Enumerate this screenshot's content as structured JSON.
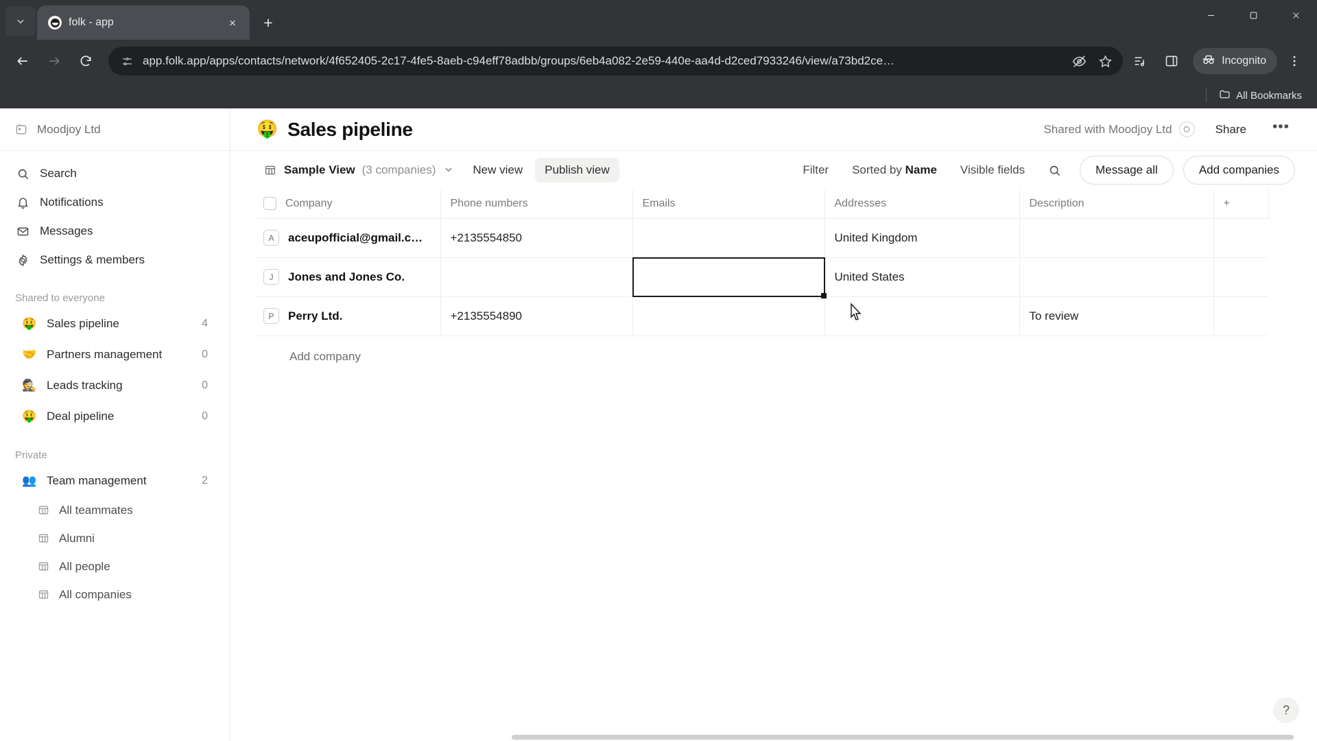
{
  "browser": {
    "tab": {
      "title": "folk - app",
      "favicon": "folk-logo-icon",
      "close_label": "×"
    },
    "new_tab_label": "+",
    "tab_search_icon": "chevron-down-icon",
    "window_controls": {
      "minimize": "minimize-icon",
      "maximize": "maximize-icon",
      "close": "close-icon"
    },
    "nav": {
      "back": "back-arrow-icon",
      "forward": "forward-arrow-icon",
      "reload": "reload-icon"
    },
    "omnibox": {
      "site_info_icon": "page-settings-icon",
      "url": "app.folk.app/apps/contacts/network/4f652405-2c17-4fe5-8aeb-c94eff78adbb/groups/6eb4a082-2e59-440e-aa4d-d2ced7933246/view/a73bd2ce…",
      "tracking_icon": "eye-off-icon",
      "bookmark_icon": "star-icon"
    },
    "toolbar_icons": {
      "reading_list": "reading-list-icon",
      "side_panel": "side-panel-icon",
      "menu": "three-dot-menu-icon"
    },
    "incognito": {
      "label": "Incognito",
      "icon": "incognito-icon"
    },
    "bookmarks": {
      "folder_icon": "folder-icon",
      "label": "All Bookmarks"
    }
  },
  "sidebar": {
    "workspace": {
      "name": "Moodjoy Ltd",
      "icon": "folk-workspace-icon"
    },
    "nav": [
      {
        "label": "Search",
        "icon": "search-icon"
      },
      {
        "label": "Notifications",
        "icon": "bell-icon"
      },
      {
        "label": "Messages",
        "icon": "envelope-icon"
      },
      {
        "label": "Settings & members",
        "icon": "gear-icon"
      }
    ],
    "shared_section_label": "Shared to everyone",
    "shared_groups": [
      {
        "emoji": "🤑",
        "label": "Sales pipeline",
        "count": "4"
      },
      {
        "emoji": "🤝",
        "label": "Partners management",
        "count": "0"
      },
      {
        "emoji": "🕵️",
        "label": "Leads tracking",
        "count": "0"
      },
      {
        "emoji": "🤑",
        "label": "Deal pipeline",
        "count": "0"
      }
    ],
    "private_section_label": "Private",
    "private_groups": [
      {
        "emoji": "👥",
        "label": "Team management",
        "count": "2"
      }
    ],
    "private_subitems": [
      {
        "label": "All teammates",
        "icon": "table-view-icon"
      },
      {
        "label": "Alumni",
        "icon": "table-view-icon"
      },
      {
        "label": "All people",
        "icon": "table-view-icon"
      },
      {
        "label": "All companies",
        "icon": "table-view-icon"
      }
    ]
  },
  "header": {
    "emoji": "🤑",
    "title": "Sales pipeline",
    "shared_with": "Shared with Moodjoy Ltd",
    "shared_avatar_icon": "workspace-avatar",
    "share_label": "Share",
    "more_label": "•••"
  },
  "view_bar": {
    "view_icon": "table-view-icon",
    "view_name": "Sample View",
    "view_count": "(3 companies)",
    "chevron": "⌄",
    "new_view_label": "New view",
    "publish_view_label": "Publish view",
    "filter_label": "Filter",
    "sorted_by_prefix": "Sorted by ",
    "sorted_by_field": "Name",
    "visible_fields_label": "Visible fields",
    "search_icon": "search-icon",
    "message_all_label": "Message all",
    "add_companies_label": "Add companies"
  },
  "table": {
    "columns": [
      "Company",
      "Phone numbers",
      "Emails",
      "Addresses",
      "Description"
    ],
    "add_column_label": "+",
    "rows": [
      {
        "avatar": "A",
        "company": "aceupofficial@gmail.c…",
        "phone": "+2135554850",
        "email": "",
        "address": "United Kingdom",
        "description": ""
      },
      {
        "avatar": "J",
        "company": "Jones and Jones Co.",
        "phone": "",
        "email": "",
        "address": "United States",
        "description": ""
      },
      {
        "avatar": "P",
        "company": "Perry Ltd.",
        "phone": "+2135554890",
        "email": "",
        "address": "",
        "description": "To review"
      }
    ],
    "selected_cell": {
      "row": 1,
      "column": "Emails"
    },
    "add_row_label": "Add company"
  },
  "help": {
    "label": "?"
  }
}
